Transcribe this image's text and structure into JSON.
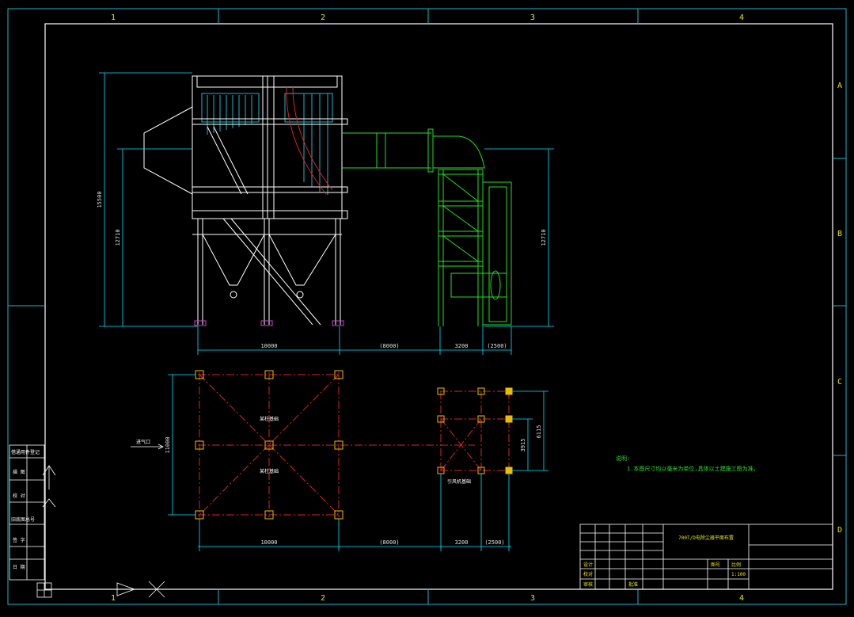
{
  "border": {
    "column_labels_top": [
      "1",
      "2",
      "3",
      "4"
    ],
    "column_labels_bottom": [
      "1",
      "2",
      "3",
      "4"
    ],
    "row_labels": [
      "A",
      "B",
      "C",
      "D"
    ]
  },
  "elevation": {
    "dims_vertical": [
      "15500",
      "12710",
      "12710"
    ],
    "dims_horizontal": [
      "10000",
      "(8000)",
      "3200",
      "(2500)"
    ]
  },
  "plan": {
    "dims_vertical": [
      "11000",
      "3915",
      "6115"
    ],
    "dims_horizontal": [
      "10000",
      "(8000)",
      "3200",
      "(2500)"
    ],
    "inlet_label": "进气口",
    "column_labels": [
      "某柱基础",
      "某柱基础"
    ],
    "fan_label": "引风机基础"
  },
  "notes": {
    "title": "说明:",
    "line1": "1.本图尺寸均以毫米为单位,具体以土建施工图为准。"
  },
  "title_block": {
    "title": "700T/D电除尘器平面布置",
    "scale": "1:100",
    "cells": [
      "设计",
      "校对",
      "审核",
      "批准",
      "图号",
      "比例"
    ]
  },
  "side_panel": {
    "labels": [
      "借通用件登记",
      "描 图",
      "校 对",
      "旧底图总号",
      "签 字",
      "日 期"
    ]
  },
  "colors": {
    "frame": "#ffffff",
    "structure": "#ffffff",
    "dimension": "#00e5ff",
    "duct": "#22e022",
    "centerline": "#e02020",
    "column_marker": "#e6c000",
    "accent": "#e0c000"
  }
}
